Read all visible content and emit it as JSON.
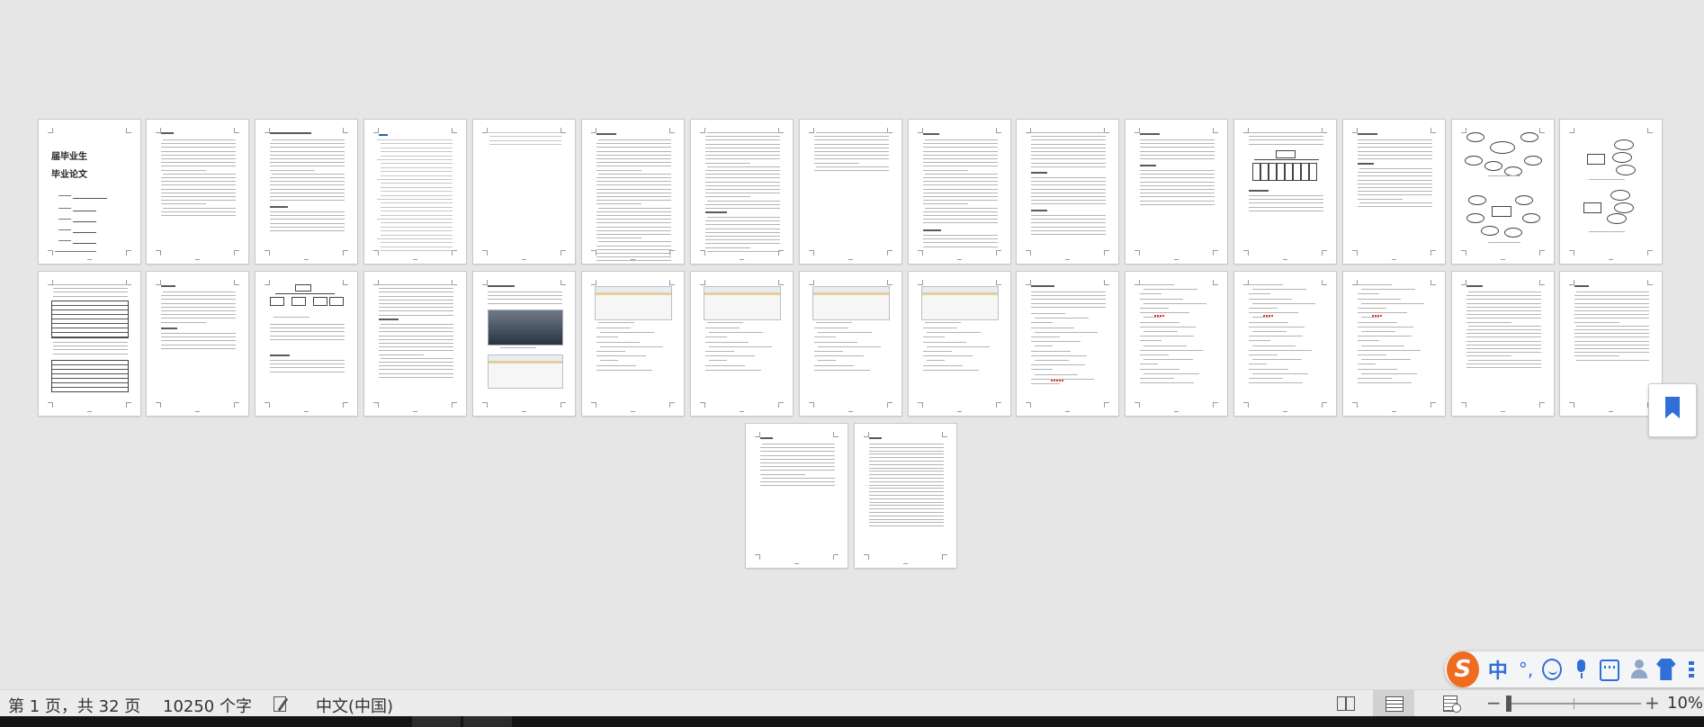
{
  "document": {
    "cover": {
      "title_line1": "届毕业生",
      "title_line2": "毕业论文"
    }
  },
  "status_bar": {
    "page_info": "第 1 页，共 32 页",
    "word_count": "10250 个字",
    "language": "中文(中国)",
    "zoom": "10%"
  },
  "ime_toolbar": {
    "logo": "S",
    "mode": "中",
    "punctuation": "°,"
  },
  "icons": {
    "bookmark": "bookmark-icon",
    "proofing": "proofing-icon",
    "read_mode": "read-mode-icon",
    "print_layout": "print-layout-icon",
    "web_layout": "web-layout-icon",
    "zoom_out": "minus-icon",
    "zoom_in": "plus-icon"
  },
  "colors": {
    "workspace": "#e6e6e6",
    "ime_accent": "#2f6fd6",
    "ime_logo": "#ef6b1f",
    "bookmark": "#2f6fd6"
  }
}
